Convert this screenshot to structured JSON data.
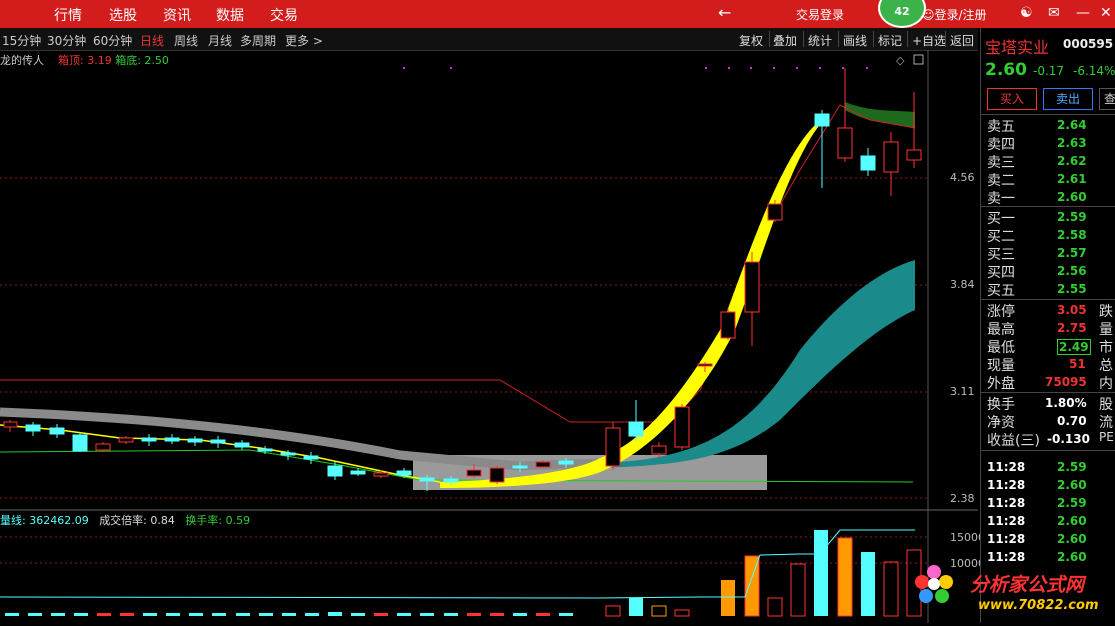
{
  "topbar": {
    "nav": [
      "行情",
      "选股",
      "资讯",
      "数据",
      "交易"
    ],
    "trade_login": "交易登录",
    "badge": "42",
    "login": "登录/注册"
  },
  "toolbar": {
    "periods": [
      "15分钟",
      "30分钟",
      "60分钟",
      "日线",
      "周线",
      "月线",
      "多周期",
      "更多 >"
    ],
    "active": "日线",
    "tools": [
      "复权",
      "叠加",
      "统计",
      "画线",
      "标记",
      "+自选",
      "返回"
    ]
  },
  "indicator": {
    "name": "龙的传人",
    "box_top_label": "箱顶: 3.19",
    "box_bottom_label": "箱底: 2.50"
  },
  "price_axis": [
    "4.56",
    "3.84",
    "3.11",
    "2.38"
  ],
  "volume": {
    "header_ma": "量线: 362462.09",
    "header_ratio": "成交倍率: 0.84",
    "header_turnover": "换手率: 0.59",
    "axis": [
      "15000",
      "10000"
    ]
  },
  "stock": {
    "name": "宝塔实业",
    "code": "000595",
    "price": "2.60",
    "change": "-0.17",
    "change_pct": "-6.14%",
    "buy_label": "买入",
    "sell_label": "卖出",
    "third_btn": "查"
  },
  "order_book": {
    "asks": [
      {
        "label": "卖五",
        "price": "2.64"
      },
      {
        "label": "卖四",
        "price": "2.63"
      },
      {
        "label": "卖三",
        "price": "2.62"
      },
      {
        "label": "卖二",
        "price": "2.61"
      },
      {
        "label": "卖一",
        "price": "2.60"
      }
    ],
    "bids": [
      {
        "label": "买一",
        "price": "2.59"
      },
      {
        "label": "买二",
        "price": "2.58"
      },
      {
        "label": "买三",
        "price": "2.57"
      },
      {
        "label": "买四",
        "price": "2.56"
      },
      {
        "label": "买五",
        "price": "2.55"
      }
    ]
  },
  "stats": [
    {
      "label": "涨停",
      "value": "3.05",
      "right": "跌"
    },
    {
      "label": "最高",
      "value": "2.75",
      "right": "量"
    },
    {
      "label": "最低",
      "value": "2.49",
      "right": "市"
    },
    {
      "label": "现量",
      "value": "51",
      "right": "总"
    },
    {
      "label": "外盘",
      "value": "75095",
      "right": "内"
    },
    {
      "label": "换手",
      "value": "1.80%",
      "right": "股"
    },
    {
      "label": "净资",
      "value": "0.70",
      "right": "流"
    },
    {
      "label": "收益(三)",
      "value": "-0.130",
      "right": "PE"
    }
  ],
  "ticks": [
    {
      "time": "11:28",
      "price": "2.59"
    },
    {
      "time": "11:28",
      "price": "2.60"
    },
    {
      "time": "11:28",
      "price": "2.59"
    },
    {
      "time": "11:28",
      "price": "2.60"
    },
    {
      "time": "11:28",
      "price": "2.60"
    },
    {
      "time": "11:28",
      "price": "2.60"
    }
  ],
  "watermark": {
    "name": "分析家公式网",
    "url": "www.70822.com"
  },
  "colors": {
    "up": "#ff3333",
    "down": "#55ffff",
    "brand": "#d31d1d",
    "ma": "#ffff00"
  }
}
